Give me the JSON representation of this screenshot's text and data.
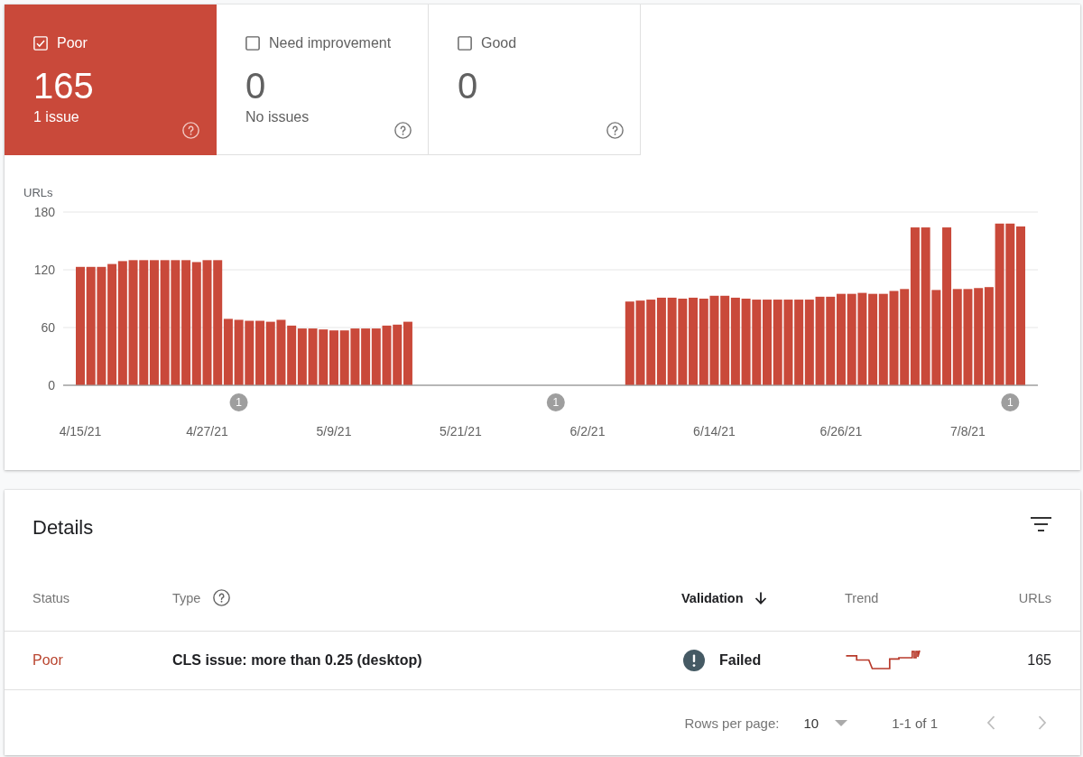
{
  "summary_tiles": [
    {
      "label": "Poor",
      "checked": true,
      "count": "165",
      "subtitle": "1 issue"
    },
    {
      "label": "Need improvement",
      "checked": false,
      "count": "0",
      "subtitle": "No issues"
    },
    {
      "label": "Good",
      "checked": false,
      "count": "0"
    }
  ],
  "chart": {
    "chart_data": {
      "type": "bar",
      "ylabel": "URLs",
      "categories": [
        "4/15/21",
        null,
        null,
        null,
        null,
        null,
        null,
        null,
        null,
        null,
        null,
        null,
        "4/27/21",
        null,
        null,
        null,
        null,
        null,
        null,
        null,
        null,
        null,
        null,
        null,
        "5/9/21",
        null,
        null,
        null,
        null,
        null,
        null,
        null,
        null,
        null,
        null,
        null,
        "5/21/21",
        null,
        null,
        null,
        null,
        null,
        null,
        null,
        null,
        null,
        null,
        null,
        "6/2/21",
        null,
        null,
        null,
        null,
        null,
        null,
        null,
        null,
        null,
        null,
        null,
        "6/14/21",
        null,
        null,
        null,
        null,
        null,
        null,
        null,
        null,
        null,
        null,
        null,
        "6/26/21",
        null,
        null,
        null,
        null,
        null,
        null,
        null,
        null,
        null,
        null,
        null,
        "7/8/21",
        null,
        null,
        null,
        null,
        null
      ],
      "series": [
        {
          "color": "#c9493a",
          "values": [
            123,
            123,
            123,
            126,
            129,
            130,
            130,
            130,
            130,
            130,
            130,
            128,
            130,
            130,
            69,
            68,
            67,
            67,
            66,
            68,
            62,
            59,
            59,
            58,
            57,
            57,
            59,
            59,
            59,
            62,
            63,
            66,
            0,
            0,
            0,
            0,
            0,
            0,
            0,
            0,
            0,
            0,
            0,
            0,
            0,
            0,
            0,
            0,
            0,
            0,
            0,
            0,
            87,
            88,
            89,
            91,
            91,
            90,
            91,
            90,
            93,
            93,
            91,
            90,
            89,
            89,
            89,
            89,
            89,
            89,
            92,
            92,
            95,
            95,
            96,
            95,
            95,
            98,
            100,
            164,
            164,
            99,
            164,
            100,
            100,
            101,
            102,
            168,
            168,
            165
          ]
        }
      ],
      "ylim": [
        0,
        180
      ],
      "yticks": [
        0,
        60,
        120,
        180
      ],
      "annotations": [
        "1",
        "1",
        "1"
      ]
    }
  },
  "details": {
    "title": "Details",
    "columns": [
      {
        "label": "Status",
        "help": false,
        "sorted": false
      },
      {
        "label": "Type",
        "help": true,
        "sorted": false
      },
      {
        "label": "Validation",
        "help": false,
        "sorted": true
      },
      {
        "label": "Trend",
        "help": false,
        "sorted": false
      },
      {
        "label": "URLs",
        "help": false,
        "sorted": false
      }
    ],
    "rows": [
      {
        "status": "Poor",
        "type": "CLS issue: more than 0.25 (desktop)",
        "validation": "Failed",
        "urls": "165"
      }
    ],
    "pagination": {
      "rows_per_page_label": "Rows per page:",
      "rows_per_page": "10",
      "range": "1-1 of 1"
    }
  }
}
